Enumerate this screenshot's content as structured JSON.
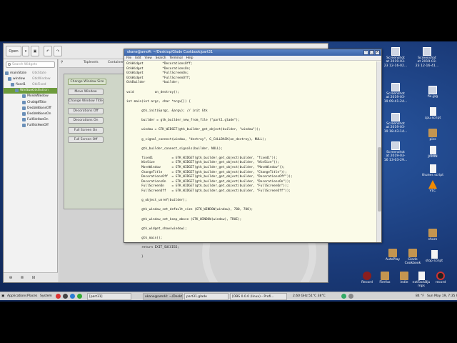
{
  "glade": {
    "open_button": "Open",
    "search_placeholder": "Search Widgets",
    "palette_tabs": [
      "Toplevels",
      "Containers"
    ],
    "tree": [
      {
        "name": "mainState",
        "cls": "GtkState",
        "indent": 2,
        "selected": false
      },
      {
        "name": "window",
        "cls": "GtkWindow",
        "indent": 6,
        "selected": false
      },
      {
        "name": "fixed1",
        "cls": "GtkFixed",
        "indent": 10,
        "selected": false
      },
      {
        "name": "WinSize",
        "cls": "GtkButton",
        "indent": 16,
        "selected": true
      },
      {
        "name": "MoveWindow",
        "cls": "GtkBu...",
        "indent": 26,
        "selected": false
      },
      {
        "name": "ChangeTitle",
        "cls": "GtkBu...",
        "indent": 26,
        "selected": false
      },
      {
        "name": "DecorationsOff",
        "cls": "GtkBu...",
        "indent": 26,
        "selected": false
      },
      {
        "name": "DecorationsOn",
        "cls": "GtkBu...",
        "indent": 26,
        "selected": false
      },
      {
        "name": "FullScreenOn",
        "cls": "GtkBu...",
        "indent": 26,
        "selected": false
      },
      {
        "name": "FullScreenOff",
        "cls": "GtkBu...",
        "indent": 26,
        "selected": false
      }
    ],
    "design_buttons": [
      "Change Window Size",
      "Move Window",
      "Change Window Title",
      "Decorations Off",
      "Decorations On",
      "Full Screen On",
      "Full Screen Off"
    ]
  },
  "terminal": {
    "title": "okane@amd4: ~/Desktop/Glade Cookbook/part31",
    "menu": [
      "File",
      "Edit",
      "View",
      "Search",
      "Terminal",
      "Help"
    ],
    "lines": [
      "GtkWidget          *DecorationsOff;",
      "GtkWidget          *DecorationsOn;",
      "GtkWidget          *FullScreenOn;",
      "GtkWidget          *FullScreenOff;",
      "GtkBuilder         *builder;",
      "",
      "void           on_destroy();",
      "",
      "int main(int argc, char *argv[]) {",
      "",
      "        gtk_init(&argc, &argv); // init Gtk",
      "",
      "        builder = gtk_builder_new_from_file (\"part1.glade\");",
      "",
      "        window = GTK_WIDGET(gtk_builder_get_object(builder, \"window\"));",
      "",
      "        g_signal_connect(window, \"destroy\", G_CALLBACK(on_destroy), NULL);",
      "",
      "        gtk_builder_connect_signals(builder, NULL);",
      "",
      "        fixed1          = GTK_WIDGET(gtk_builder_get_object(builder, \"fixed1\"));",
      "        WinSize         = GTK_WIDGET(gtk_builder_get_object(builder, \"WinSize\"));",
      "        MoveWindow      = GTK_WIDGET(gtk_builder_get_object(builder, \"MoveWindow\"));",
      "        ChangeTitle     = GTK_WIDGET(gtk_builder_get_object(builder, \"ChangeTitle\"));",
      "        DecorationsOff  = GTK_WIDGET(gtk_builder_get_object(builder, \"DecorationsOff\"));",
      "        DecorationsOn   = GTK_WIDGET(gtk_builder_get_object(builder, \"DecorationsOn\"));",
      "        FullScreenOn    = GTK_WIDGET(gtk_builder_get_object(builder, \"FullScreenOn\"));",
      "        FullScreenOff   = GTK_WIDGET(gtk_builder_get_object(builder, \"FullScreenOff\"));",
      "",
      "        g_object_unref(builder);",
      "",
      "        gtk_window_set_default_size (GTK_WINDOW(window), 700, 700);",
      "",
      "        gtk_window_set_keep_above (GTK_WINDOW(window), TRUE);",
      "",
      "        gtk_widget_show(window);",
      "",
      "        gtk_main();",
      "",
      "        return EXIT_SUCCESS;",
      "",
      "        }"
    ]
  },
  "desktop_icons": [
    {
      "label": [
        "Screenshot",
        "at 2019-03-",
        "23 12-16-02..."
      ],
      "kind": "img"
    },
    {
      "label": [
        "Screenshot",
        "at 2019-03-",
        "23 12-16-41..."
      ],
      "kind": "img"
    },
    {
      "label": [
        "Screenshot",
        "at 2019-03-",
        "19 09-41-24..."
      ],
      "kind": "img"
    },
    {
      "label": [
        "fix.jpg"
      ],
      "kind": "img"
    },
    {
      "label": [
        "Screenshot",
        "at 2019-03-",
        "19 18-43-14..."
      ],
      "kind": "img"
    },
    {
      "label": [
        "cpu.script"
      ],
      "kind": "doc"
    },
    {
      "label": [
        "Screenshot",
        "at 2019-03-",
        "16 13-03-29..."
      ],
      "kind": "img"
    },
    {
      "label": [
        "pics"
      ],
      "kind": "folder"
    },
    {
      "label": [
        "JAMIN"
      ],
      "kind": "doc"
    },
    {
      "label": [
        "thunes script"
      ],
      "kind": "doc"
    },
    {
      "label": [
        "VLC"
      ],
      "kind": "vlc"
    },
    {
      "label": [
        "share"
      ],
      "kind": "folder"
    },
    {
      "label": [
        "AutoPlay"
      ],
      "kind": "folder"
    },
    {
      "label": [
        "Glade",
        "Cookbook"
      ],
      "kind": "folder"
    },
    {
      "label": [
        "stop script"
      ],
      "kind": "doc"
    },
    {
      "label": [
        "Record"
      ],
      "kind": "rec"
    },
    {
      "label": [
        "Firefox"
      ],
      "kind": "folder"
    },
    {
      "label": [
        "indie"
      ],
      "kind": "folder"
    },
    {
      "label": [
        "notTackBju",
        "mps"
      ],
      "kind": "doc"
    },
    {
      "label": [
        "record"
      ],
      "kind": "mic"
    }
  ],
  "taskbar": {
    "menus": [
      "Applications",
      "Places",
      "System"
    ],
    "tasks": [
      {
        "label": "[part31]",
        "active": false
      },
      {
        "label": "okane@amd4: ~/Deskt...",
        "active": true
      },
      {
        "label": "part31.glade",
        "active": false
      },
      {
        "label": "[OBS 0.0.0 (linux) - Profi...",
        "active": false
      }
    ],
    "status": "2.60 GHz   51°C   38°C",
    "clock": "Sun May 19,  7:35 PM",
    "temp": "84 °F"
  },
  "colors": {
    "desktop": "#1c3f7a",
    "selection": "#6d9b3c",
    "title_bar": "#3a62a8"
  }
}
